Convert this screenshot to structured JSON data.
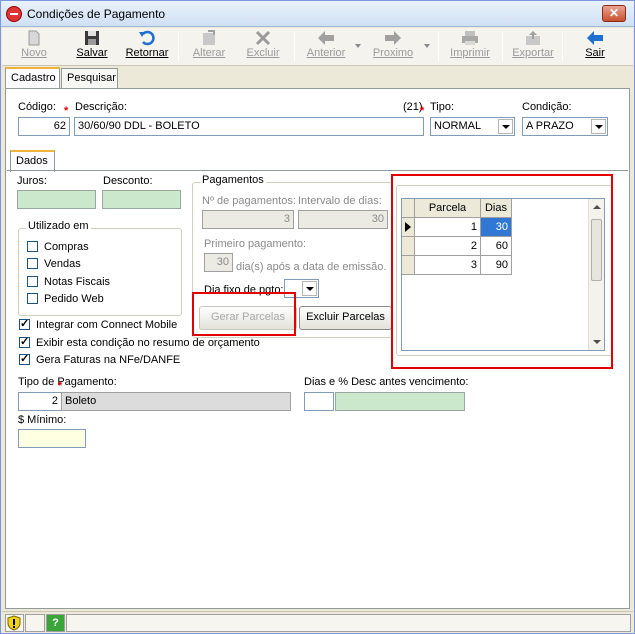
{
  "window": {
    "title": "Condições de Pagamento"
  },
  "toolbar": {
    "novo": "Novo",
    "salvar": "Salvar",
    "retornar": "Retornar",
    "alterar": "Alterar",
    "excluir": "Excluir",
    "anterior": "Anterior",
    "proximo": "Proximo",
    "imprimir": "Imprimir",
    "exportar": "Exportar",
    "sair": "Sair"
  },
  "tabs": {
    "cadastro": "Cadastro",
    "pesquisar": "Pesquisar",
    "dados": "Dados"
  },
  "form": {
    "codigo_label": "Código:",
    "codigo_value": "62",
    "descricao_label": "Descrição:",
    "descricao_value": "30/60/90 DDL - BOLETO",
    "descricao_counter": "(21)",
    "tipo_label": "Tipo:",
    "tipo_value": "NORMAL",
    "condicao_label": "Condição:",
    "condicao_value": "A PRAZO",
    "juros_label": "Juros:",
    "desconto_label": "Desconto:",
    "utilizado_em_label": "Utilizado em",
    "compras": "Compras",
    "vendas": "Vendas",
    "notas_fiscais": "Notas Fiscais",
    "pedido_web": "Pedido Web",
    "integrar": "Integrar com Connect Mobile",
    "exibir": "Exibir esta condição no resumo de orçamento",
    "gera_faturas": "Gera Faturas na NFe/DANFE",
    "tipo_pagamento_label": "Tipo de Pagamento:",
    "tipo_pagamento_code": "2",
    "tipo_pagamento_value": "Boleto",
    "minimo_label": "$ Mínimo:",
    "dias_desc_label": "Dias e % Desc antes vencimento:"
  },
  "checks": {
    "compras": false,
    "vendas": false,
    "notas_fiscais": false,
    "pedido_web": false,
    "integrar": true,
    "exibir": true,
    "gera_faturas": true
  },
  "pagamentos": {
    "label": "Pagamentos",
    "n_pagamentos_label": "Nº de pagamentos:",
    "n_pagamentos_value": "3",
    "intervalo_label": "Intervalo de dias:",
    "intervalo_value": "30",
    "primeiro_label": "Primeiro pagamento:",
    "primeiro_value": "30",
    "primeiro_suffix": "dia(s) após a data de emissão.",
    "dia_fixo_label": "Dia fixo de pgto:",
    "gerar_button": "Gerar Parcelas",
    "excluir_button": "Excluir Parcelas"
  },
  "parcelas_grid": {
    "headers": [
      "Parcela",
      "Dias"
    ],
    "rows": [
      {
        "parcela": "1",
        "dias": "30"
      },
      {
        "parcela": "2",
        "dias": "60"
      },
      {
        "parcela": "3",
        "dias": "90"
      }
    ]
  }
}
